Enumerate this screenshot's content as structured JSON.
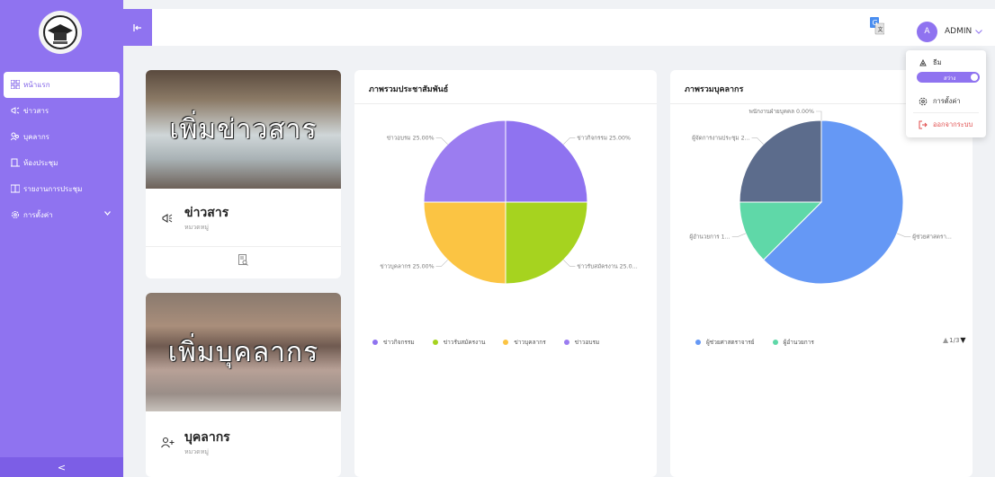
{
  "sidebar": {
    "items": [
      {
        "label": "หน้าแรก",
        "icon": "grid-icon",
        "active": true
      },
      {
        "label": "ข่าวสาร",
        "icon": "megaphone-icon"
      },
      {
        "label": "บุคลากร",
        "icon": "users-icon"
      },
      {
        "label": "ห้องประชุม",
        "icon": "meeting-room-icon"
      },
      {
        "label": "รายงานการประชุม",
        "icon": "report-icon"
      },
      {
        "label": "การตั้งค่า",
        "icon": "gear-icon",
        "has_submenu": true
      }
    ],
    "collapse_label": "<"
  },
  "topbar": {
    "toggle_label": "|←",
    "user": {
      "initial": "A",
      "name": "ADMIN"
    }
  },
  "user_menu": {
    "theme_label": "ธีม",
    "theme_value": "สว่าง",
    "settings_label": "การตั้งค่า",
    "logout_label": "ออกจากระบบ"
  },
  "cards": {
    "news": {
      "overlay": "เพิ่มข่าวสาร",
      "title": "ข่าวสาร",
      "subtitle": "หมวดหมู่"
    },
    "staff": {
      "overlay": "เพิ่มบุคลากร",
      "title": "บุคลากร",
      "subtitle": "หมวดหมู่"
    }
  },
  "colors": {
    "accent": "#8f73f0",
    "pr_purple": "#8f73f0",
    "pr_green": "#a6d31f",
    "pr_yellow": "#fbc443",
    "pr_violet": "#9b7df0",
    "staff_blue": "#6598f5",
    "staff_teal": "#5fd8a8",
    "staff_slate": "#5c6c8c",
    "logout_red": "#e04a4a"
  },
  "chart_data": [
    {
      "type": "pie",
      "title": "ภาพรวมประชาสัมพันธ์",
      "slices": [
        {
          "name": "ข่าวกิจกรรม",
          "value": 25.0,
          "label": "ข่าวกิจกรรม 25.00%"
        },
        {
          "name": "ข่าวรับสมัครงาน",
          "value": 25.0,
          "label": "ข่าวรับสมัครงาน 25.0..."
        },
        {
          "name": "ข่าวบุคลากร",
          "value": 25.0,
          "label": "ข่าวบุคลากร 25.00%"
        },
        {
          "name": "ข่าวอบรม",
          "value": 25.0,
          "label": "ข่าวอบรม 25.00%"
        }
      ],
      "legend": [
        "ข่าวกิจกรรม",
        "ข่าวรับสมัครงาน",
        "ข่าวบุคลากร",
        "ข่าวอบรม"
      ],
      "legend_position": "bottom"
    },
    {
      "type": "pie",
      "title": "ภาพรวมบุคลากร",
      "slices": [
        {
          "name": "ผู้ช่วยศาสตราจารย์",
          "value": 62.5,
          "label": "ผู้ช่วยศาสตรา..."
        },
        {
          "name": "ผู้อำนวยการ",
          "value": 12.5,
          "label": "ผู้อำนวยการ 1..."
        },
        {
          "name": "ผู้จัดการงานประชุม",
          "value": 25.0,
          "label": "ผู้จัดการงานประชุม 2..."
        },
        {
          "name": "พนักงานฝ่ายบุคคล",
          "value": 0.0,
          "label": "พนักงานฝ่ายบุคคล 0.00%"
        }
      ],
      "legend": [
        "ผู้ช่วยศาสตราจารย์",
        "ผู้อำนวยการ"
      ],
      "legend_pager": "1/3",
      "legend_position": "bottom"
    }
  ]
}
